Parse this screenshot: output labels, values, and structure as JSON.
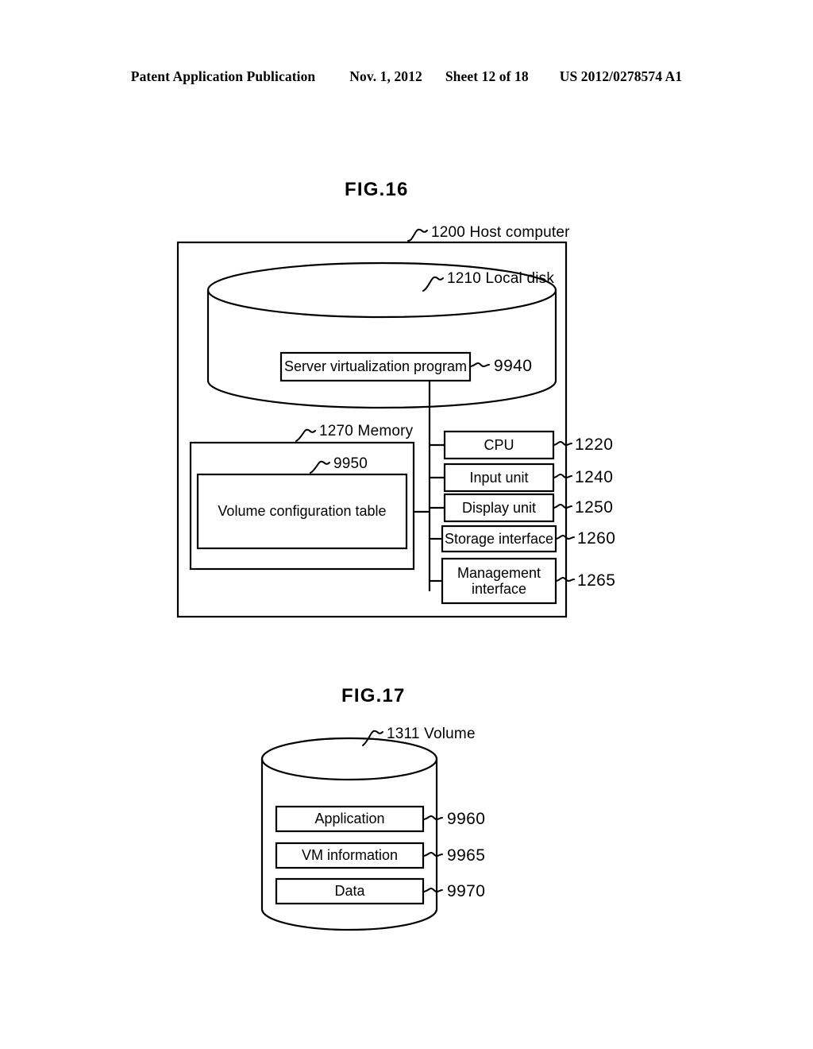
{
  "header": {
    "publication": "Patent Application Publication",
    "date": "Nov. 1, 2012",
    "sheet": "Sheet 12 of 18",
    "docnumber": "US 2012/0278574 A1"
  },
  "figures": [
    {
      "id": "fig16",
      "title": "FIG.16",
      "callouts": [
        {
          "name": "host-computer",
          "ref": "1200",
          "text": "1200 Host computer"
        },
        {
          "name": "local-disk",
          "ref": "1210",
          "text": "1210 Local disk"
        },
        {
          "name": "memory",
          "ref": "1270",
          "text": "1270 Memory"
        },
        {
          "name": "volume-config-table",
          "ref": "9950",
          "text": "9950"
        }
      ],
      "disk_program": {
        "label": "Server virtualization program",
        "ref": "9940"
      },
      "memory_table": {
        "label": "Volume configuration table",
        "ref": "9950"
      },
      "components": [
        {
          "label": "CPU",
          "ref": "1220"
        },
        {
          "label": "Input unit",
          "ref": "1240"
        },
        {
          "label": "Display unit",
          "ref": "1250"
        },
        {
          "label": "Storage interface",
          "ref": "1260"
        },
        {
          "label": "Management\ninterface",
          "ref": "1265"
        }
      ]
    },
    {
      "id": "fig17",
      "title": "FIG.17",
      "callouts": [
        {
          "name": "volume",
          "ref": "1311",
          "text": "1311 Volume"
        }
      ],
      "contents": [
        {
          "label": "Application",
          "ref": "9960"
        },
        {
          "label": "VM information",
          "ref": "9965"
        },
        {
          "label": "Data",
          "ref": "9970"
        }
      ]
    }
  ],
  "colors": {
    "ink": "#000000",
    "paper": "#ffffff"
  }
}
